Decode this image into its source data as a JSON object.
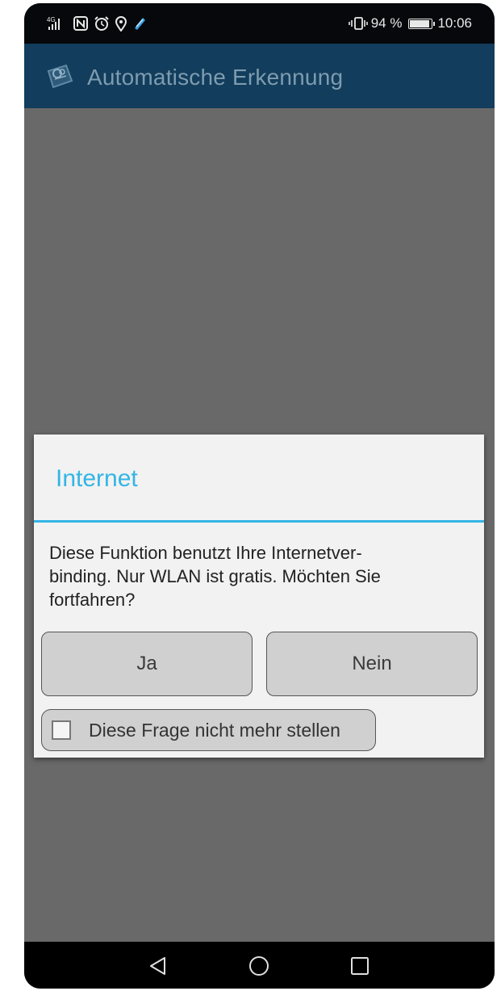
{
  "status_bar": {
    "network": "4G",
    "battery_percent": "94 %",
    "time": "10:06",
    "icons": [
      "signal-icon",
      "nfc-icon",
      "alarm-icon",
      "location-icon",
      "app-notification-icon",
      "vibrate-icon",
      "battery-icon"
    ]
  },
  "app_bar": {
    "title": "Automatische Erkennung",
    "logo_icon": "app-logo-icon"
  },
  "dialog": {
    "title": "Internet",
    "message": "Diese Funktion benutzt Ihre Internetver-\nbinding. Nur WLAN ist gratis. Möchten Sie\nfortfahren?",
    "yes_label": "Ja",
    "no_label": "Nein",
    "checkbox_label": "Diese Frage nicht mehr stellen",
    "checkbox_checked": false,
    "accent_color": "#33b5e5"
  },
  "nav_bar": {
    "buttons": [
      "back-icon",
      "home-icon",
      "recents-icon"
    ]
  },
  "colors": {
    "app_bar": "#123d5c",
    "scrim": "#696969",
    "status_bar": "#06080b"
  }
}
